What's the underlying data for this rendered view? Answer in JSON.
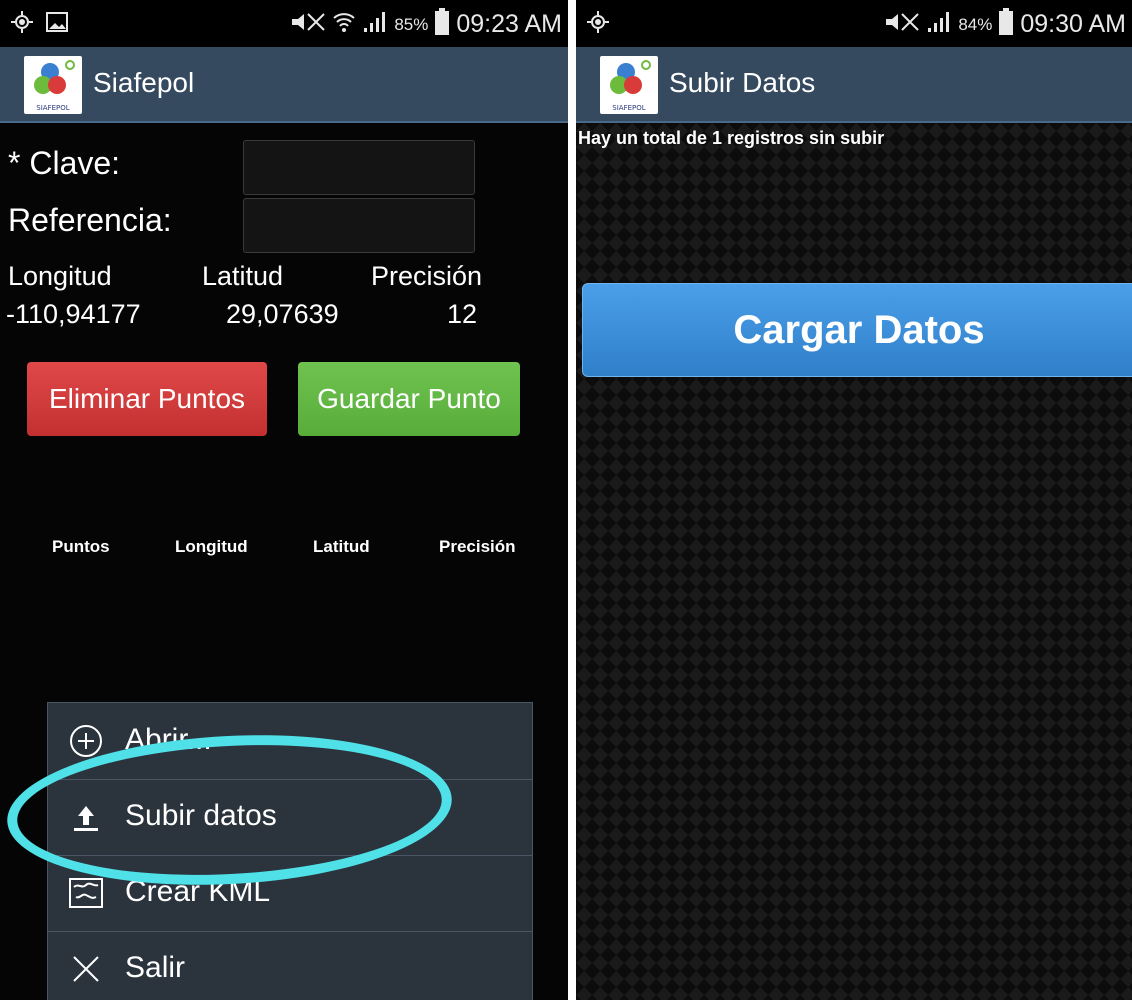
{
  "left": {
    "status": {
      "battery": "85%",
      "time": "09:23 AM"
    },
    "app_title": "Siafepol",
    "logo_text": "SIAFEPOL",
    "clave_label": "* Clave:",
    "referencia_label": "Referencia:",
    "coords": {
      "headers": [
        "Longitud",
        "Latitud",
        "Precisión"
      ],
      "values": [
        "-110,94177",
        "29,07639",
        "12"
      ]
    },
    "eliminar_label": "Eliminar Puntos",
    "guardar_label": "Guardar Punto",
    "table_headers": [
      "Puntos",
      "Longitud",
      "Latitud",
      "Precisión"
    ],
    "menu": [
      {
        "label": "Abrir...",
        "icon": "plus-circle-icon"
      },
      {
        "label": "Subir datos",
        "icon": "upload-icon"
      },
      {
        "label": "Crear KML",
        "icon": "map-icon"
      },
      {
        "label": "Salir",
        "icon": "close-icon"
      }
    ],
    "highlight_color": "#4fe0e8"
  },
  "right": {
    "status": {
      "battery": "84%",
      "time": "09:30 AM"
    },
    "app_title": "Subir Datos",
    "logo_text": "SIAFEPOL",
    "info_text": "Hay un total de 1 registros sin subir",
    "cargar_label": "Cargar Datos"
  }
}
